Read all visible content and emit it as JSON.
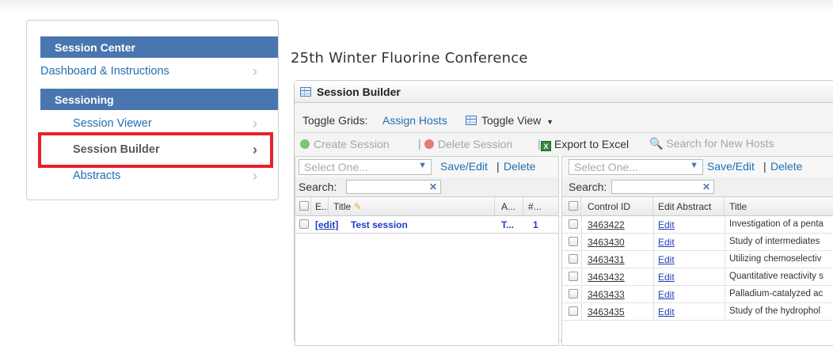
{
  "sidebar": {
    "section1": "Session Center",
    "item_dashboard": "Dashboard & Instructions",
    "section2": "Sessioning",
    "item_viewer": "Session Viewer",
    "item_builder": "Session Builder",
    "item_abstracts": "Abstracts",
    "chevron": "›"
  },
  "conference_title": "25th Winter Fluorine Conference",
  "panel": {
    "title": "Session Builder",
    "toggle_grids_label": "Toggle Grids:",
    "assign_hosts": "Assign Hosts",
    "toggle_view": "Toggle View",
    "create_session": "Create Session",
    "delete_session": "Delete Session",
    "export_excel": "Export to Excel",
    "search_hosts": "Search for New Hosts"
  },
  "left_grid": {
    "select_placeholder": "Select One...",
    "save_edit": "Save/Edit",
    "delete": "Delete",
    "search_label": "Search:",
    "columns": [
      "E...",
      "Title",
      "A...",
      "#..."
    ],
    "rows": [
      {
        "edit": "[edit]",
        "title": "Test session",
        "a": "T...",
        "count": "1"
      }
    ]
  },
  "right_grid": {
    "select_placeholder": "Select One...",
    "save_edit": "Save/Edit",
    "delete": "Delete",
    "search_label": "Search:",
    "columns": [
      "Control ID",
      "Edit Abstract",
      "Title"
    ],
    "rows": [
      {
        "id": "3463422",
        "edit": "Edit",
        "title": "Investigation of a penta"
      },
      {
        "id": "3463430",
        "edit": "Edit",
        "title": "Study of intermediates"
      },
      {
        "id": "3463431",
        "edit": "Edit",
        "title": "Utilizing chemoselectiv"
      },
      {
        "id": "3463432",
        "edit": "Edit",
        "title": "Quantitative reactivity s"
      },
      {
        "id": "3463433",
        "edit": "Edit",
        "title": "Palladium-catalyzed ac"
      },
      {
        "id": "3463435",
        "edit": "Edit",
        "title": "Study of the hydrophol"
      }
    ]
  },
  "colors": {
    "header_blue": "#4a76b0",
    "link_blue": "#1f6fb2",
    "highlight_red": "#e8202a",
    "create_green": "#5cb85c",
    "delete_red": "#d9534f"
  }
}
